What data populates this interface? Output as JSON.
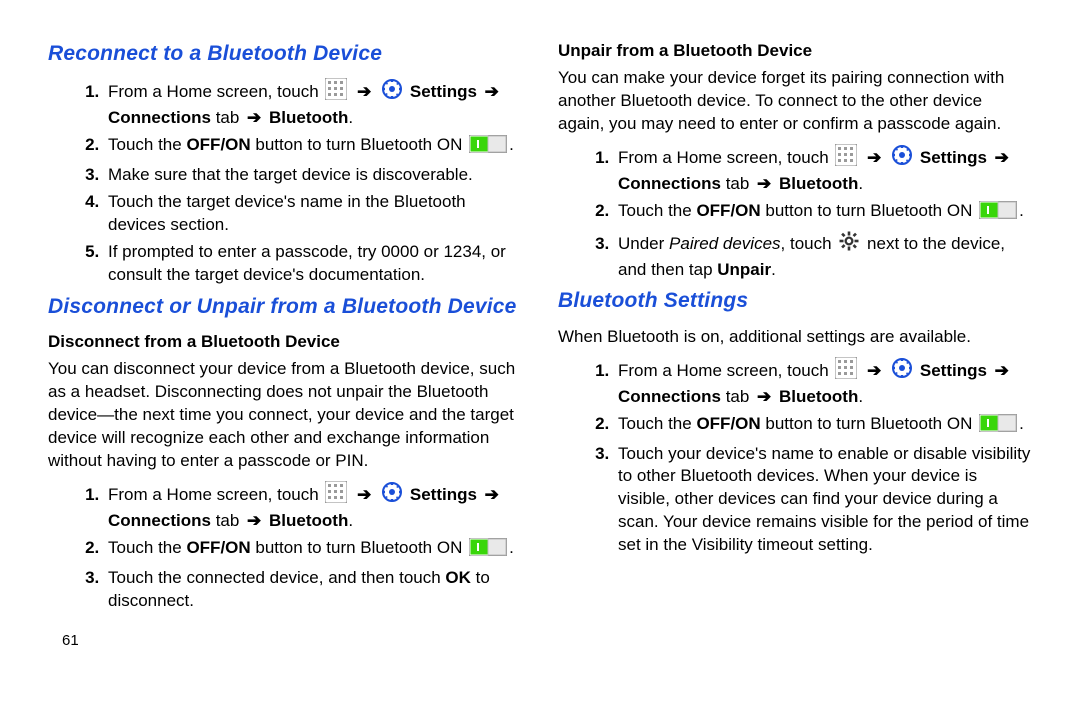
{
  "page_number": "61",
  "arrow": "➔",
  "icons": {
    "apps": "apps-grid-icon",
    "settings_gear": "settings-gear-icon",
    "toggle_on": "toggle-on-icon",
    "gear_solid": "gear-solid-icon"
  },
  "left": {
    "h1a": "Reconnect to a Bluetooth Device",
    "steps_a": {
      "1_pre": "From a Home screen, touch ",
      "1_post_settings": " Settings ",
      "1_line2": "Connections",
      "1_line2_tab": " tab ",
      "1_line2_bt": " Bluetooth",
      "1_line2_period": ".",
      "2_a": "Touch the ",
      "2_b": "OFF/ON",
      "2_c": " button to turn Bluetooth ON ",
      "2_d": ".",
      "3": "Make sure that the target device is discoverable.",
      "4": "Touch the target device's name in the Bluetooth devices section.",
      "5": "If prompted to enter a passcode, try 0000 or 1234, or consult the target device's documentation."
    },
    "h1b": "Disconnect or Unpair from a Bluetooth Device",
    "h2b": "Disconnect from a Bluetooth Device",
    "para_b": "You can disconnect your device from a Bluetooth device, such as a headset. Disconnecting does not unpair the Bluetooth device—the next time you connect, your device and the target device will recognize each other and exchange information without having to enter a passcode or PIN.",
    "steps_b": {
      "1_pre": "From a Home screen, touch ",
      "1_post_settings": " Settings ",
      "1_line2": "Connections",
      "1_line2_tab": " tab ",
      "1_line2_bt": " Bluetooth",
      "1_line2_period": ".",
      "2_a": "Touch the ",
      "2_b": "OFF/ON",
      "2_c": " button to turn Bluetooth ON ",
      "2_d": ".",
      "3_a": "Touch the connected device, and then touch ",
      "3_b": "OK",
      "3_c": " to disconnect."
    }
  },
  "right": {
    "h2a": "Unpair from a Bluetooth Device",
    "para_a": "You can make your device forget its pairing connection with another Bluetooth device. To connect to the other device again, you may need to enter or confirm a passcode again.",
    "steps_a": {
      "1_pre": "From a Home screen, touch ",
      "1_post_settings": " Settings ",
      "1_line2": "Connections",
      "1_line2_tab": " tab ",
      "1_line2_bt": " Bluetooth",
      "1_line2_period": ".",
      "2_a": "Touch the ",
      "2_b": "OFF/ON",
      "2_c": " button to turn Bluetooth ON ",
      "2_d": ".",
      "3_a": "Under ",
      "3_b": "Paired devices",
      "3_c": ", touch ",
      "3_d": " next to the device, and then tap ",
      "3_e": "Unpair",
      "3_f": "."
    },
    "h1b": "Bluetooth Settings",
    "para_b": "When Bluetooth is on, additional settings are available.",
    "steps_b": {
      "1_pre": "From a Home screen, touch ",
      "1_post_settings": " Settings ",
      "1_line2": "Connections",
      "1_line2_tab": " tab ",
      "1_line2_bt": " Bluetooth",
      "1_line2_period": ".",
      "2_a": "Touch the ",
      "2_b": "OFF/ON",
      "2_c": " button to turn Bluetooth ON ",
      "2_d": ".",
      "3": "Touch your device's name to enable or disable visibility to other Bluetooth devices. When your device is visible, other devices can find your device during a scan. Your device remains visible for the period of time set in the Visibility timeout setting."
    }
  }
}
